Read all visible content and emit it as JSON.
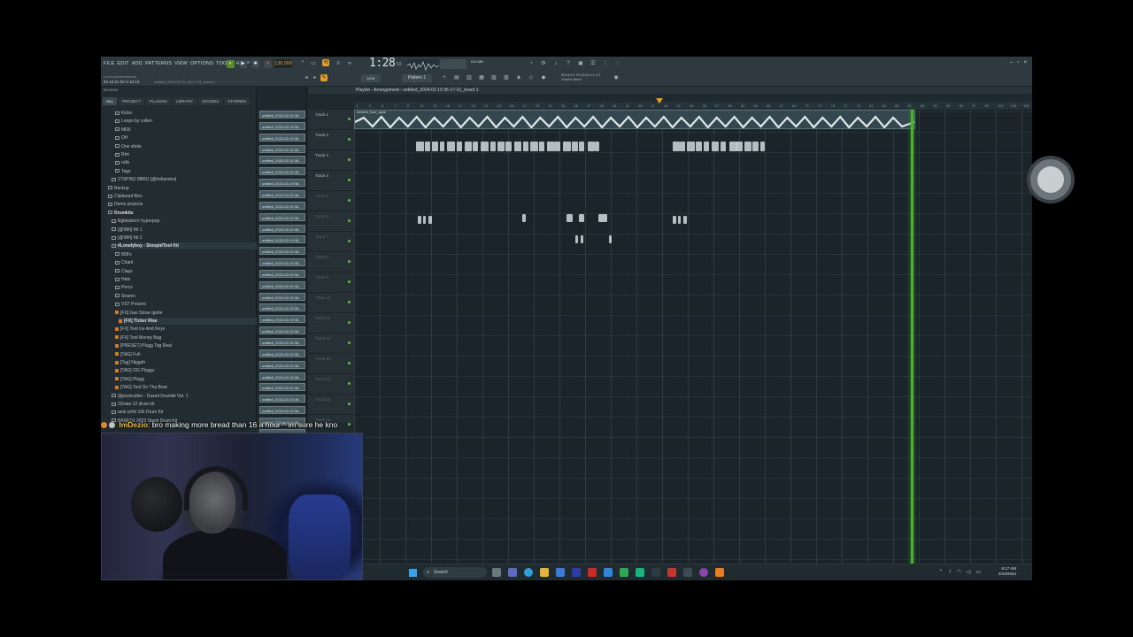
{
  "menu": [
    "FILE",
    "EDIT",
    "ADD",
    "PATTERNS",
    "VIEW",
    "OPTIONS",
    "TOOLS",
    "HELP"
  ],
  "toolbar": {
    "tempo": "130.000",
    "time": "1:28",
    "time_small": "53",
    "pattern": "Pattern 1",
    "mode": "Line",
    "cpu": "815 MB",
    "hint_line1": "LoveLoveHammered",
    "hint_line2": "94 10:21 for 0 10:13",
    "song_small": "untitled_2024-02-19_06-17-31_Insert 1",
    "news_title": "00/16 FL STUDIO 21.2.3",
    "news_sub": "What's New?"
  },
  "browser": {
    "title": "Browser",
    "tabs": [
      "ALL",
      "PROJECT",
      "PLUGINS",
      "LIBRARY",
      "SOUNDS",
      "STARRED"
    ],
    "items": [
      {
        "label": "Kicks",
        "indent": 2,
        "type": "folder"
      },
      {
        "label": "Loops by cullen",
        "indent": 2,
        "type": "folder"
      },
      {
        "label": "MIDI",
        "indent": 2,
        "type": "folder"
      },
      {
        "label": "OH",
        "indent": 2,
        "type": "folder"
      },
      {
        "label": "One shots",
        "indent": 2,
        "type": "folder"
      },
      {
        "label": "Rim",
        "indent": 2,
        "type": "folder"
      },
      {
        "label": "rolls",
        "indent": 2,
        "type": "folder"
      },
      {
        "label": "Tags",
        "indent": 2,
        "type": "folder"
      },
      {
        "label": "1TSPINZ 8BB1I [@hellarolex]",
        "indent": 1,
        "type": "folder"
      },
      {
        "label": "Backup",
        "indent": 0,
        "type": "folder"
      },
      {
        "label": "Clipboard files",
        "indent": 0,
        "type": "folder"
      },
      {
        "label": "Demo projects",
        "indent": 0,
        "type": "folder"
      },
      {
        "label": "Drumkits",
        "indent": 0,
        "type": "folder",
        "bold": true
      },
      {
        "label": "lilgbladerrrr hyperpop",
        "indent": 1,
        "type": "folder"
      },
      {
        "label": "[@Wifi] Kit 1",
        "indent": 1,
        "type": "folder"
      },
      {
        "label": "[@Wifi] Kit 2",
        "indent": 1,
        "type": "folder"
      },
      {
        "label": "#Lonelyboy - StoopidTool Kit",
        "indent": 1,
        "type": "folder",
        "bold": true,
        "hl": true
      },
      {
        "label": "808's",
        "indent": 2,
        "type": "folder"
      },
      {
        "label": "Chant",
        "indent": 2,
        "type": "folder"
      },
      {
        "label": "Claps",
        "indent": 2,
        "type": "folder"
      },
      {
        "label": "Hats",
        "indent": 2,
        "type": "folder"
      },
      {
        "label": "Percs",
        "indent": 2,
        "type": "folder"
      },
      {
        "label": "Snares",
        "indent": 2,
        "type": "folder"
      },
      {
        "label": "VST Presets",
        "indent": 2,
        "type": "folder"
      },
      {
        "label": "[FX] Gas Stove Ignite",
        "indent": 2,
        "type": "file"
      },
      {
        "label": "[FX] Ticker Rise",
        "indent": 3,
        "type": "file",
        "bold": true,
        "hl": true
      },
      {
        "label": "[FX] Tool Ice And Keys",
        "indent": 2,
        "type": "file"
      },
      {
        "label": "[FX] Tool Money Bag",
        "indent": 2,
        "type": "file"
      },
      {
        "label": "[PRESET] Plugg Tag Real",
        "indent": 2,
        "type": "file"
      },
      {
        "label": "[TAG] Fuh",
        "indent": 2,
        "type": "file"
      },
      {
        "label": "[Tag] Niggah",
        "indent": 2,
        "type": "file"
      },
      {
        "label": "[TAG] OG Pluggz",
        "indent": 2,
        "type": "file"
      },
      {
        "label": "[TAG] Plugg",
        "indent": 2,
        "type": "file"
      },
      {
        "label": "[TAG] Tool On Tha Beat",
        "indent": 2,
        "type": "file"
      },
      {
        "label": "@prodcullen - Dazed Drumkit Vol. 1",
        "indent": 1,
        "type": "folder"
      },
      {
        "label": "22nate 22 drum kit",
        "indent": 1,
        "type": "folder"
      },
      {
        "label": "amir pr0d 10k Drum Kit",
        "indent": 1,
        "type": "folder"
      },
      {
        "label": "BASED1 2023 Stash Drum Kit",
        "indent": 1,
        "type": "folder"
      }
    ]
  },
  "clips": [
    "untitled_2024-02-19 06-",
    "untitled_2024-02-19 06-",
    "untitled_2024-02-19 06-",
    "untitled_2024-02-19 06-",
    "untitled_2024-02-19 06-",
    "untitled_2024-02-19 06-",
    "untitled_2024-02-19 06-",
    "untitled_2024-02-19 06-",
    "untitled_2024-02-19 06-",
    "untitled_2024-02-19 06-",
    "untitled_2024-02-19 06-",
    "untitled_2024-02-19 06-",
    "untitled_2024-02-19 06-",
    "untitled_2024-02-19 06-",
    "untitled_2024-02-19 06-",
    "untitled_2024-02-19 06-",
    "untitled_2024-02-19 06-",
    "untitled_2024-02-19 06-",
    "untitled_2024-02-19 06-",
    "untitled_2024-02-19 06-",
    "untitled_2024-02-19 06-",
    "untitled_2024-02-19 06-",
    "untitled_2024-02-19 06-",
    "untitled_2024-02-19 06-",
    "untitled_2024-02-19 06-",
    "untitled_2024-02-19 06-",
    "untitled_2024-02-19 06-",
    "untitled_2024-02-19 06-",
    "untitled_2024-02-19 06-"
  ],
  "playlist": {
    "title": "Playlist - Arrangement › untitled_2024-02-19 06-17-31_Insert 1",
    "tracks": [
      "Track 1",
      "Track 2",
      "Track 3",
      "Track 4",
      "Track 5",
      "Track 6",
      "Track 7",
      "Track 8",
      "Track 9",
      "Track 10",
      "Track 11",
      "Track 12",
      "Track 13",
      "Track 14",
      "Track 15",
      "Track 16"
    ],
    "track1_clip_label": "Ambient_Hard_spark",
    "ruler": [
      "1",
      "3",
      "5",
      "7",
      "9",
      "11",
      "13",
      "15",
      "17",
      "19",
      "21",
      "23",
      "25",
      "27",
      "29",
      "31",
      "33",
      "35",
      "37",
      "39",
      "41",
      "43",
      "45",
      "47",
      "49",
      "51",
      "53",
      "55",
      "57",
      "59",
      "61",
      "63",
      "65",
      "67",
      "69",
      "71",
      "73",
      "75",
      "77",
      "79",
      "81",
      "83",
      "85",
      "87",
      "89",
      "91",
      "93",
      "95",
      "97",
      "99",
      "101",
      "103",
      "105"
    ]
  },
  "taskbar": {
    "search": "Search",
    "time": "6:17 AM",
    "date": "2/19/2024"
  },
  "chat": {
    "user": "ImDezio",
    "message": ": bro making more bread than 16 a hour ^ im sure he kno"
  },
  "colors": {
    "playhead": "#4caf36",
    "accent_orange": "#e3a12e",
    "record": "#e0463a"
  }
}
